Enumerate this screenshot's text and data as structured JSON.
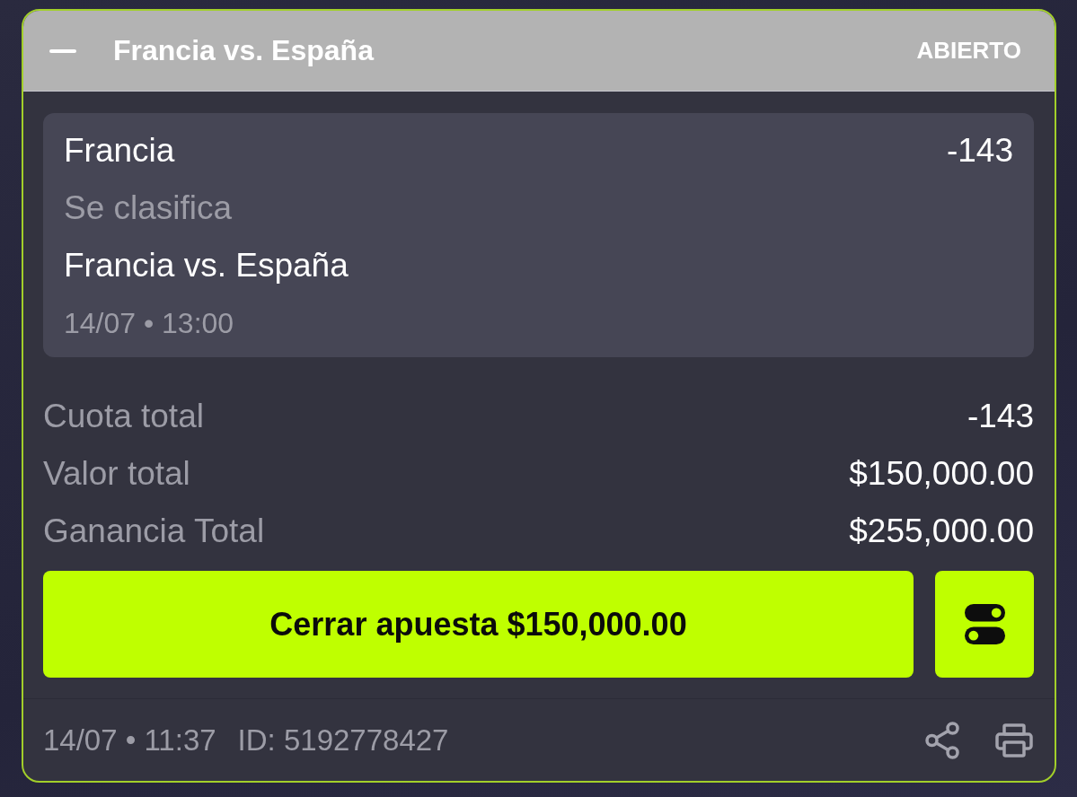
{
  "bet": {
    "expanded": true,
    "title": "Francia vs. España",
    "status": "ABIERTO"
  },
  "selection": {
    "team": "Francia",
    "odds": "-143",
    "market": "Se clasifica",
    "event": "Francia vs. España",
    "date": "14/07 • 13:00"
  },
  "summary": [
    {
      "label": "Cuota total",
      "value": "-143"
    },
    {
      "label": "Valor total",
      "value": "$150,000.00"
    },
    {
      "label": "Ganancia Total",
      "value": "$255,000.00"
    }
  ],
  "actions": {
    "cash_out": "Cerrar apuesta $150,000.00"
  },
  "footer": {
    "placed": "14/07 • 11:37",
    "id": "ID: 5192778427"
  }
}
